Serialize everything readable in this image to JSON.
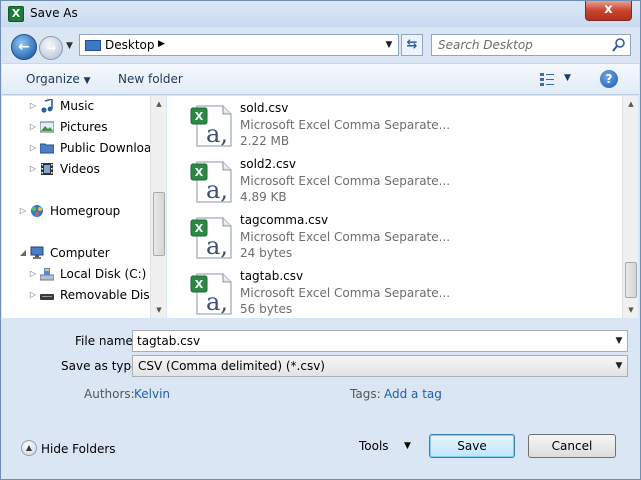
{
  "window": {
    "title": "Save As",
    "app_icon": "excel-icon",
    "close_label": "x"
  },
  "address": {
    "location": "Desktop",
    "search_placeholder": "Search Desktop"
  },
  "toolbar": {
    "organize_label": "Organize",
    "new_folder_label": "New folder"
  },
  "nav": {
    "items": [
      {
        "label": "Music",
        "icon": "music-icon",
        "expandable": true
      },
      {
        "label": "Pictures",
        "icon": "pictures-icon",
        "expandable": true
      },
      {
        "label": "Public Download",
        "icon": "folder-icon",
        "expandable": true
      },
      {
        "label": "Videos",
        "icon": "videos-icon",
        "expandable": true
      },
      {
        "label": "Homegroup",
        "icon": "homegroup-icon",
        "expandable": true
      },
      {
        "label": "Computer",
        "icon": "computer-icon",
        "expandable": true
      },
      {
        "label": "Local Disk (C:)",
        "icon": "drive-icon",
        "expandable": true
      },
      {
        "label": "Removable Disk (",
        "icon": "removable-drive-icon",
        "expandable": true
      }
    ]
  },
  "files": [
    {
      "name": "sold.csv",
      "type": "Microsoft Excel Comma Separate...",
      "size": "2.22 MB"
    },
    {
      "name": "sold2.csv",
      "type": "Microsoft Excel Comma Separate...",
      "size": "4.89 KB"
    },
    {
      "name": "tagcomma.csv",
      "type": "Microsoft Excel Comma Separate...",
      "size": "24 bytes"
    },
    {
      "name": "tagtab.csv",
      "type": "Microsoft Excel Comma Separate...",
      "size": "56 bytes"
    }
  ],
  "form": {
    "file_name_label": "File name:",
    "file_name_value": "tagtab.csv",
    "save_type_label": "Save as type:",
    "save_type_value": "CSV (Comma delimited) (*.csv)",
    "authors_label": "Authors:",
    "authors_value": "Kelvin",
    "tags_label": "Tags:",
    "tags_value": "Add a tag"
  },
  "footer": {
    "hide_folders_label": "Hide Folders",
    "tools_label": "Tools",
    "save_label": "Save",
    "cancel_label": "Cancel"
  }
}
